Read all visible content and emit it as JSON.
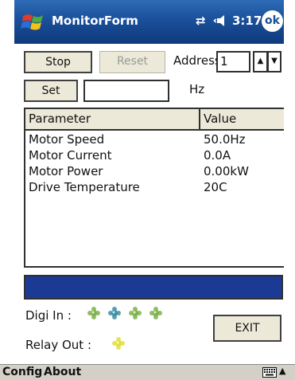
{
  "titlebar": {
    "app_title": "MonitorForm",
    "clock": "3:17",
    "ok_label": "ok",
    "connectivity_glyph": "⇄",
    "icons": [
      "windows-logo-icon",
      "connectivity-icon",
      "volume-icon"
    ],
    "color": "#1a4f9a"
  },
  "controls": {
    "stop_label": "Stop",
    "reset_label": "Reset",
    "address_label": "Address",
    "address_value": "1",
    "spin_up": "▲",
    "spin_down": "▼",
    "set_label": "Set",
    "frequency_value": "",
    "unit_label": "Hz"
  },
  "list": {
    "columns": [
      "Parameter",
      "Value"
    ],
    "rows": [
      {
        "parameter": "Motor Speed",
        "value": "50.0Hz"
      },
      {
        "parameter": "Motor Current",
        "value": "0.0A"
      },
      {
        "parameter": "Motor Power",
        "value": "0.00kW"
      },
      {
        "parameter": "Drive Temperature",
        "value": "20C"
      }
    ]
  },
  "progress": {
    "fraction": 1.0,
    "color": "#1b3a94"
  },
  "io": {
    "digi_in_label": "Digi In :",
    "relay_out_label": "Relay Out :",
    "digital_inputs": [
      {
        "name": "di-1",
        "color": "#7db34a"
      },
      {
        "name": "di-2",
        "color": "#3d8fa3"
      },
      {
        "name": "di-3",
        "color": "#7db34a"
      },
      {
        "name": "di-4",
        "color": "#7db34a"
      }
    ],
    "relay_outputs": [
      {
        "name": "relay-1",
        "color": "#e3df3a"
      }
    ]
  },
  "exit_label": "EXIT",
  "menubar": {
    "config_label": "Config",
    "about_label": "About",
    "icons": [
      "keyboard-icon",
      "sip-arrow-icon"
    ]
  }
}
